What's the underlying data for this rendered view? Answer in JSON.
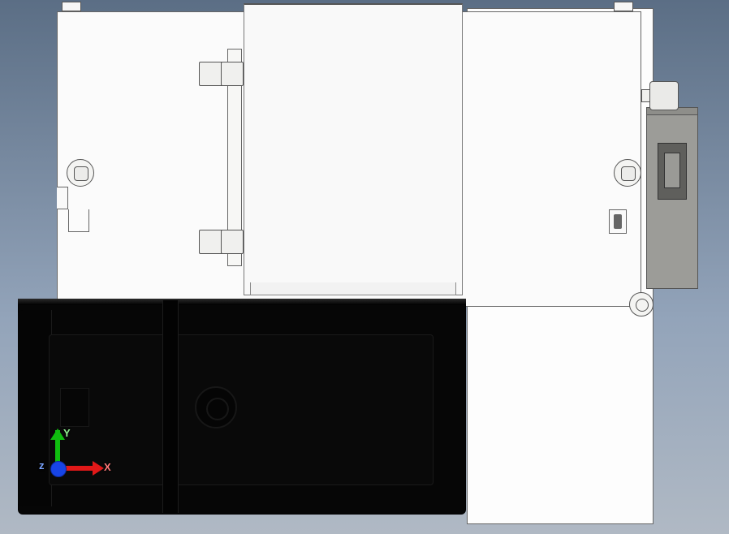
{
  "triad": {
    "x_label": "X",
    "y_label": "Y",
    "z_label": "z"
  }
}
